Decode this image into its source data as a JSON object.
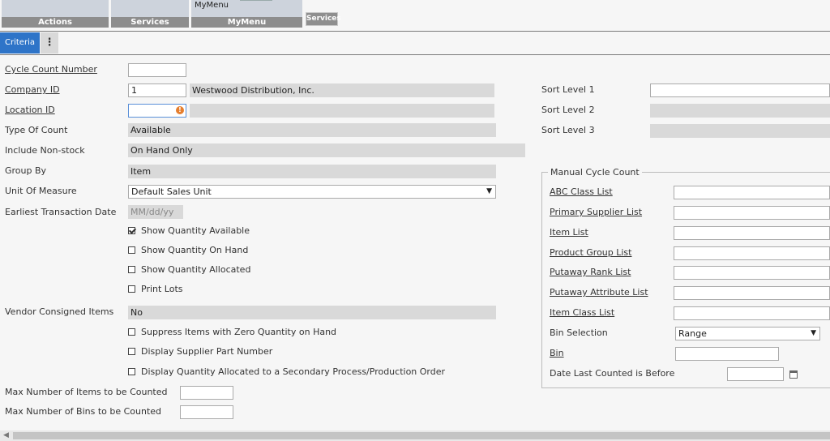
{
  "ribbon": {
    "groups": [
      {
        "label": "Actions",
        "title": ""
      },
      {
        "label": "Services",
        "title": ""
      },
      {
        "label": "MyMenu",
        "title": "MyMenu"
      }
    ],
    "services_chip": "Services"
  },
  "tabs": {
    "criteria": "Criteria"
  },
  "form": {
    "cycle_count_number": {
      "label": "Cycle Count Number",
      "value": ""
    },
    "company_id": {
      "label": "Company ID",
      "value": "1",
      "description": "Westwood Distribution, Inc."
    },
    "location_id": {
      "label": "Location ID",
      "value": "",
      "description": ""
    },
    "type_of_count": {
      "label": "Type Of Count",
      "value": "Available"
    },
    "include_non_stock": {
      "label": "Include Non-stock",
      "value": "On Hand Only"
    },
    "group_by": {
      "label": "Group By",
      "value": "Item"
    },
    "unit_of_measure": {
      "label": "Unit Of Measure",
      "value": "Default Sales Unit"
    },
    "earliest_transaction_date": {
      "label": "Earliest Transaction Date",
      "placeholder": "MM/dd/yy"
    },
    "show_quantity_available": {
      "label": "Show Quantity Available",
      "checked": true
    },
    "show_quantity_on_hand": {
      "label": "Show Quantity On Hand",
      "checked": false
    },
    "show_quantity_allocated": {
      "label": "Show Quantity Allocated",
      "checked": false
    },
    "print_lots": {
      "label": "Print Lots",
      "checked": false
    },
    "vendor_consigned_items": {
      "label": "Vendor Consigned Items",
      "value": "No"
    },
    "suppress_zero": {
      "label": "Suppress Items with Zero Quantity on Hand",
      "checked": false
    },
    "display_supplier_part": {
      "label": "Display Supplier Part Number",
      "checked": false
    },
    "display_qty_secondary": {
      "label": "Display Quantity Allocated to a Secondary Process/Production Order",
      "checked": false
    },
    "max_items": {
      "label": "Max Number of Items to be Counted",
      "value": ""
    },
    "max_bins": {
      "label": "Max Number of Bins to be Counted",
      "value": ""
    },
    "sort_level_1": {
      "label": "Sort Level 1",
      "value": ""
    },
    "sort_level_2": {
      "label": "Sort Level 2",
      "value": ""
    },
    "sort_level_3": {
      "label": "Sort Level 3",
      "value": ""
    }
  },
  "manual_cycle_count": {
    "legend": "Manual Cycle Count",
    "abc_class_list": "ABC Class List",
    "primary_supplier_list": "Primary Supplier List",
    "item_list": "Item List",
    "product_group_list": "Product Group List",
    "putaway_rank_list": "Putaway Rank List",
    "putaway_attribute_list": "Putaway Attribute List",
    "item_class_list": "Item Class List",
    "bin_selection": {
      "label": "Bin Selection",
      "value": "Range"
    },
    "bin": "Bin",
    "date_last_counted": "Date Last Counted is Before"
  },
  "colors": {
    "tab_active": "#2e74c8",
    "readonly_bg": "#d9d9d9",
    "error_icon": "#e57e2e"
  }
}
